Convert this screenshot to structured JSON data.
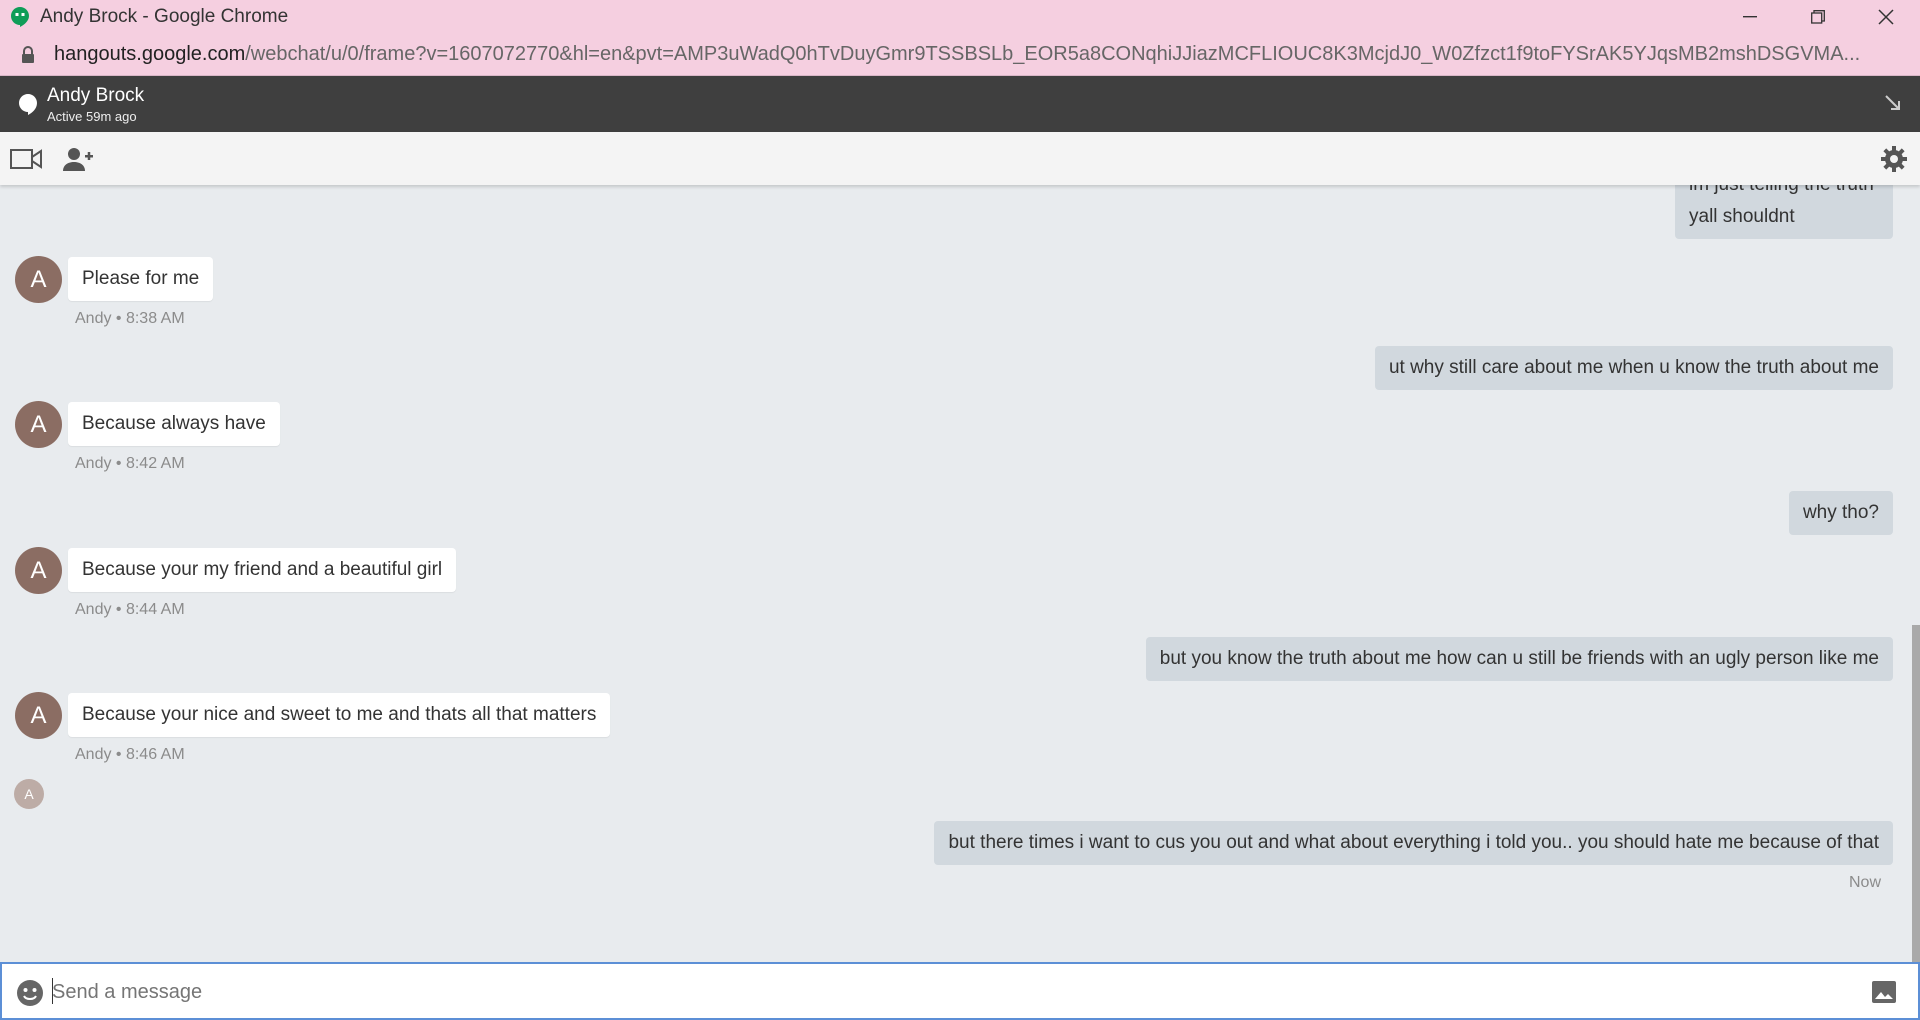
{
  "window": {
    "title": "Andy Brock - Google Chrome"
  },
  "address": {
    "domain": "hangouts.google.com",
    "path": "/webchat/u/0/frame?v=1607072770&hl=en&pvt=AMP3uWadQ0hTvDuyGmr9TSSBSLb_EOR5a8CONqhiJJiazMCFLIOUC8K3McjdJ0_W0Zfzct1f9toFYSrAK5YJqsMB2mshDSGVMA..."
  },
  "header": {
    "name": "Andy Brock",
    "status": "Active 59m ago"
  },
  "messages": {
    "top_partial_line1": "im just telling the truth",
    "top_partial_line2": "yall shouldnt",
    "m1": "Please for me",
    "m1_meta": "Andy • 8:38 AM",
    "m2": "ut why still care about me when u know the truth about me",
    "m3": "Because always have",
    "m3_meta": "Andy • 8:42 AM",
    "m4": "why tho?",
    "m5": "Because your my friend and a beautiful girl",
    "m5_meta": "Andy • 8:44 AM",
    "m6": "but you know the truth about me how can u still be friends with an ugly person like me",
    "m7": "Because your nice and sweet to me and thats all that matters",
    "m7_meta": "Andy • 8:46 AM",
    "m8": "but there times i want to cus you out and what about everything i told you.. you should hate me because of that",
    "m8_meta": "Now"
  },
  "avatar_letter": "A",
  "composer": {
    "placeholder": "Send a message"
  },
  "colors": {
    "titlebar": "#f5cfe0",
    "header": "#3f3f3f",
    "avatar": "#8b6d63",
    "outgoing_bubble": "#d1d8de",
    "incoming_bubble": "#ffffff"
  }
}
